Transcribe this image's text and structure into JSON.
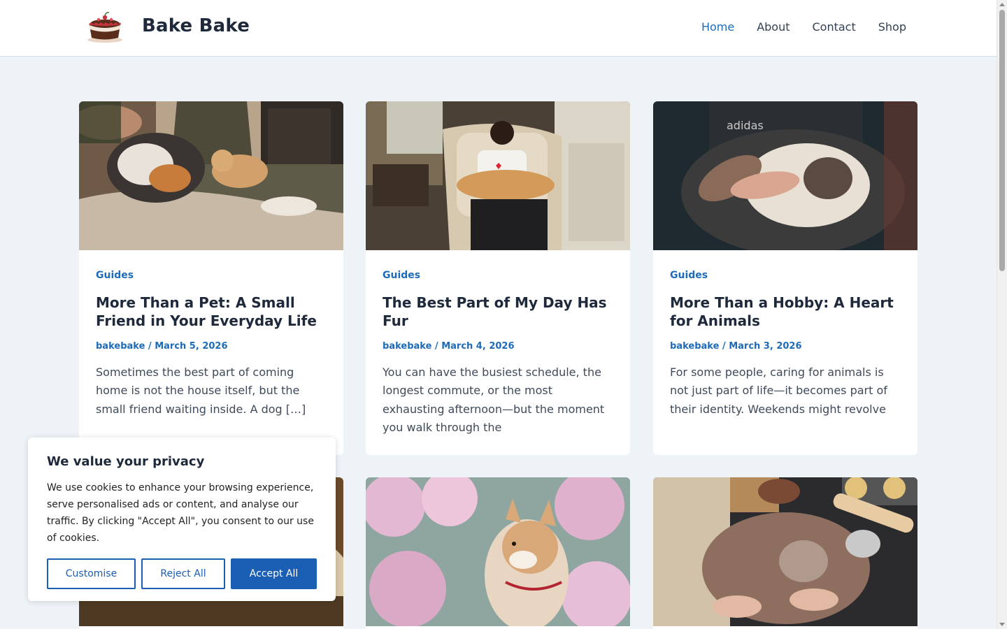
{
  "site": {
    "title": "Bake Bake"
  },
  "nav": {
    "items": [
      "Home",
      "About",
      "Contact",
      "Shop"
    ],
    "active": "Home"
  },
  "posts": [
    {
      "category": "Guides",
      "title": "More Than a Pet: A Small Friend in Your Everyday Life",
      "author": "bakebake",
      "date": "March 5, 2026",
      "excerpt": "Sometimes the best part of coming home is not the house itself, but the small friend waiting inside. A dog […]"
    },
    {
      "category": "Guides",
      "title": "The Best Part of My Day Has Fur",
      "author": "bakebake",
      "date": "March 4, 2026",
      "excerpt": "You can have the busiest schedule, the longest commute, or the most exhausting afternoon—but the moment you walk through the"
    },
    {
      "category": "Guides",
      "title": "More Than a Hobby: A Heart for Animals",
      "author": "bakebake",
      "date": "March 3, 2026",
      "excerpt": "For some people, caring for animals is not just part of life—it becomes part of their identity. Weekends might revolve"
    }
  ],
  "cookie": {
    "title": "We value your privacy",
    "text": "We use cookies to enhance your browsing experience, serve personalised ads or content, and analyse our traffic. By clicking \"Accept All\", you consent to our use of cookies.",
    "customise_label": "Customise",
    "reject_label": "Reject All",
    "accept_label": "Accept All"
  },
  "colors": {
    "accent": "#1e6bb8",
    "button": "#1a5fb4",
    "background": "#eef3f8",
    "heading": "#1e293b"
  },
  "icons": {
    "logo": "cake-logo-icon"
  }
}
